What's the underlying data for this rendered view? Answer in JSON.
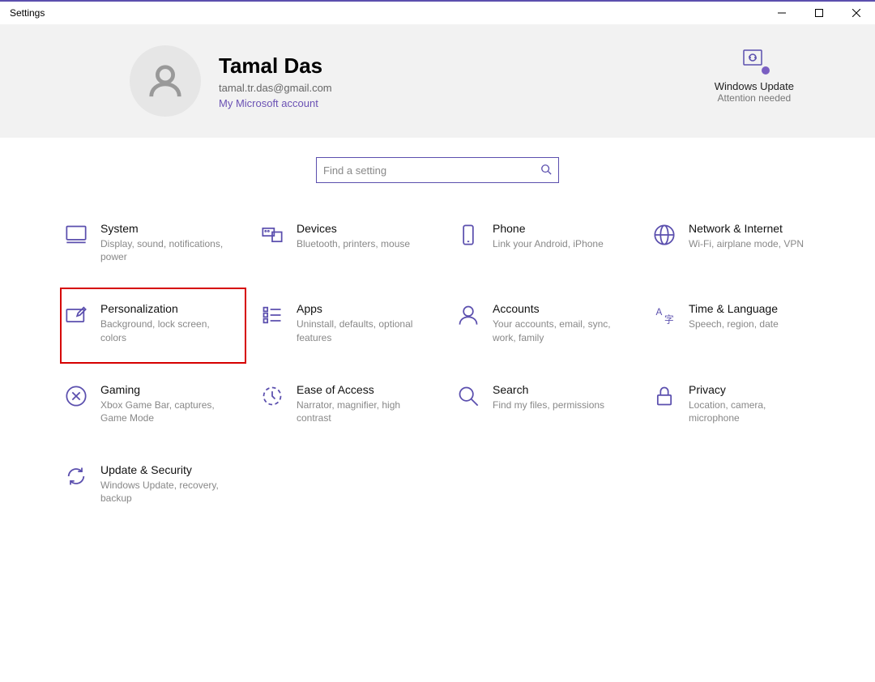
{
  "window": {
    "title": "Settings"
  },
  "user": {
    "name": "Tamal Das",
    "email": "tamal.tr.das@gmail.com",
    "ms_account": "My Microsoft account"
  },
  "windows_update": {
    "title": "Windows Update",
    "subtitle": "Attention needed"
  },
  "search": {
    "placeholder": "Find a setting"
  },
  "tiles": {
    "system": {
      "title": "System",
      "desc": "Display, sound, notifications, power"
    },
    "devices": {
      "title": "Devices",
      "desc": "Bluetooth, printers, mouse"
    },
    "phone": {
      "title": "Phone",
      "desc": "Link your Android, iPhone"
    },
    "network": {
      "title": "Network & Internet",
      "desc": "Wi-Fi, airplane mode, VPN"
    },
    "personalization": {
      "title": "Personalization",
      "desc": "Background, lock screen, colors"
    },
    "apps": {
      "title": "Apps",
      "desc": "Uninstall, defaults, optional features"
    },
    "accounts": {
      "title": "Accounts",
      "desc": "Your accounts, email, sync, work, family"
    },
    "time": {
      "title": "Time & Language",
      "desc": "Speech, region, date"
    },
    "gaming": {
      "title": "Gaming",
      "desc": "Xbox Game Bar, captures, Game Mode"
    },
    "ease": {
      "title": "Ease of Access",
      "desc": "Narrator, magnifier, high contrast"
    },
    "search_tile": {
      "title": "Search",
      "desc": "Find my files, permissions"
    },
    "privacy": {
      "title": "Privacy",
      "desc": "Location, camera, microphone"
    },
    "update": {
      "title": "Update & Security",
      "desc": "Windows Update, recovery, backup"
    }
  },
  "colors": {
    "accent": "#5b4fae",
    "highlight": "#d60000"
  }
}
